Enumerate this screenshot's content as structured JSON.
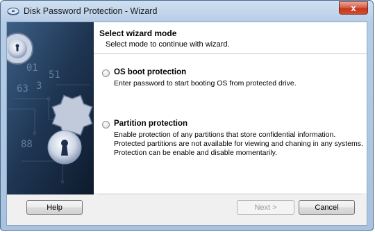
{
  "window": {
    "title": "Disk Password Protection - Wizard",
    "close_label": "x",
    "icon": "disk-key-icon"
  },
  "header": {
    "title": "Select wizard mode",
    "subtitle": "Select mode to continue with wizard."
  },
  "options": [
    {
      "title": "OS boot protection",
      "description": [
        "Enter password to start booting OS from protected drive."
      ],
      "selected": false
    },
    {
      "title": "Partition protection",
      "description": [
        "Enable protection of any partitions that store confidential information.",
        "Protected partitions are not available for viewing and chaning in any systems.",
        "Protection can be enable and disable momentarily."
      ],
      "selected": false
    }
  ],
  "buttons": {
    "help": "Help",
    "next": "Next >",
    "cancel": "Cancel"
  },
  "banner": {
    "icon": "gear-lock-icon",
    "digits": [
      "01",
      "63",
      "3",
      "51",
      "88"
    ]
  }
}
